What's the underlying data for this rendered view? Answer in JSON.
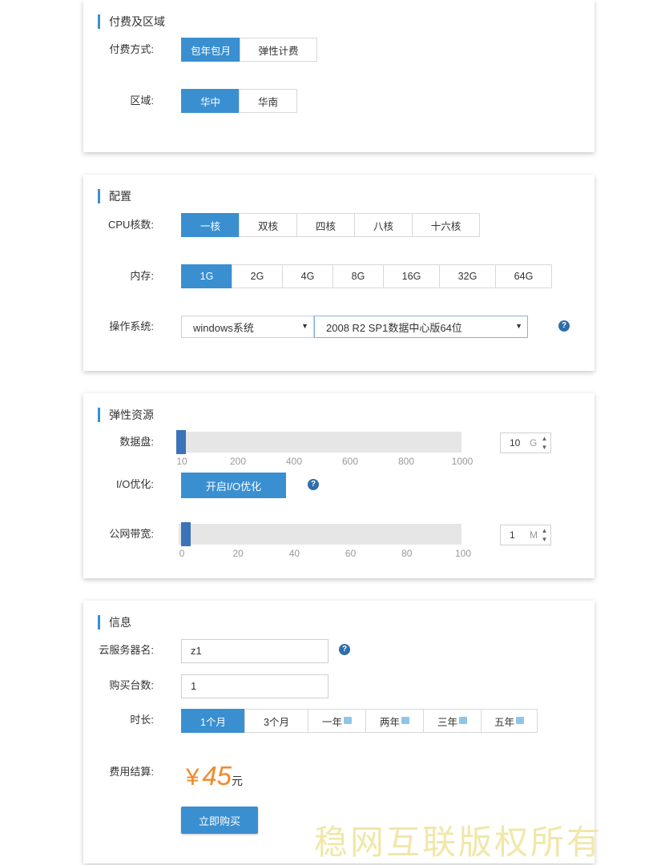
{
  "billing": {
    "title": "付费及区域",
    "payment_label": "付费方式:",
    "payment_options": [
      "包年包月",
      "弹性计费"
    ],
    "region_label": "区域:",
    "region_options": [
      "华中",
      "华南"
    ]
  },
  "config": {
    "title": "配置",
    "cpu_label": "CPU核数:",
    "cpu_options": [
      "一核",
      "双核",
      "四核",
      "八核",
      "十六核"
    ],
    "memory_label": "内存:",
    "memory_options": [
      "1G",
      "2G",
      "4G",
      "8G",
      "16G",
      "32G",
      "64G"
    ],
    "os_label": "操作系统:",
    "os_family": "windows系统",
    "os_version": "2008 R2 SP1数据中心版64位"
  },
  "elastic": {
    "title": "弹性资源",
    "disk_label": "数据盘:",
    "disk_ticks": [
      "10",
      "200",
      "400",
      "600",
      "800",
      "1000"
    ],
    "disk_value": "10",
    "disk_unit": "G",
    "disk_level": 0,
    "io_label": "I/O优化:",
    "io_button": "开启I/O优化",
    "bandwidth_label": "公网带宽:",
    "bandwidth_ticks": [
      "0",
      "20",
      "40",
      "60",
      "80",
      "100"
    ],
    "bandwidth_value": "1",
    "bandwidth_unit": "M",
    "bandwidth_level": 1
  },
  "info": {
    "title": "信息",
    "name_label": "云服务器名:",
    "name_value": "z1",
    "count_label": "购买台数:",
    "count_value": "1",
    "duration_label": "时长:",
    "duration_options": [
      "1个月",
      "3个月",
      "一年",
      "两年",
      "三年",
      "五年"
    ],
    "cost_label": "费用结算:",
    "currency_symbol": "¥",
    "price": "45",
    "price_unit": "元",
    "buy_button": "立即购买"
  },
  "watermark": "稳网互联版权所有",
  "colors": {
    "accent": "#3a8fd0",
    "price": "#f08a2c",
    "slider_thumb": "#3b73b8"
  }
}
